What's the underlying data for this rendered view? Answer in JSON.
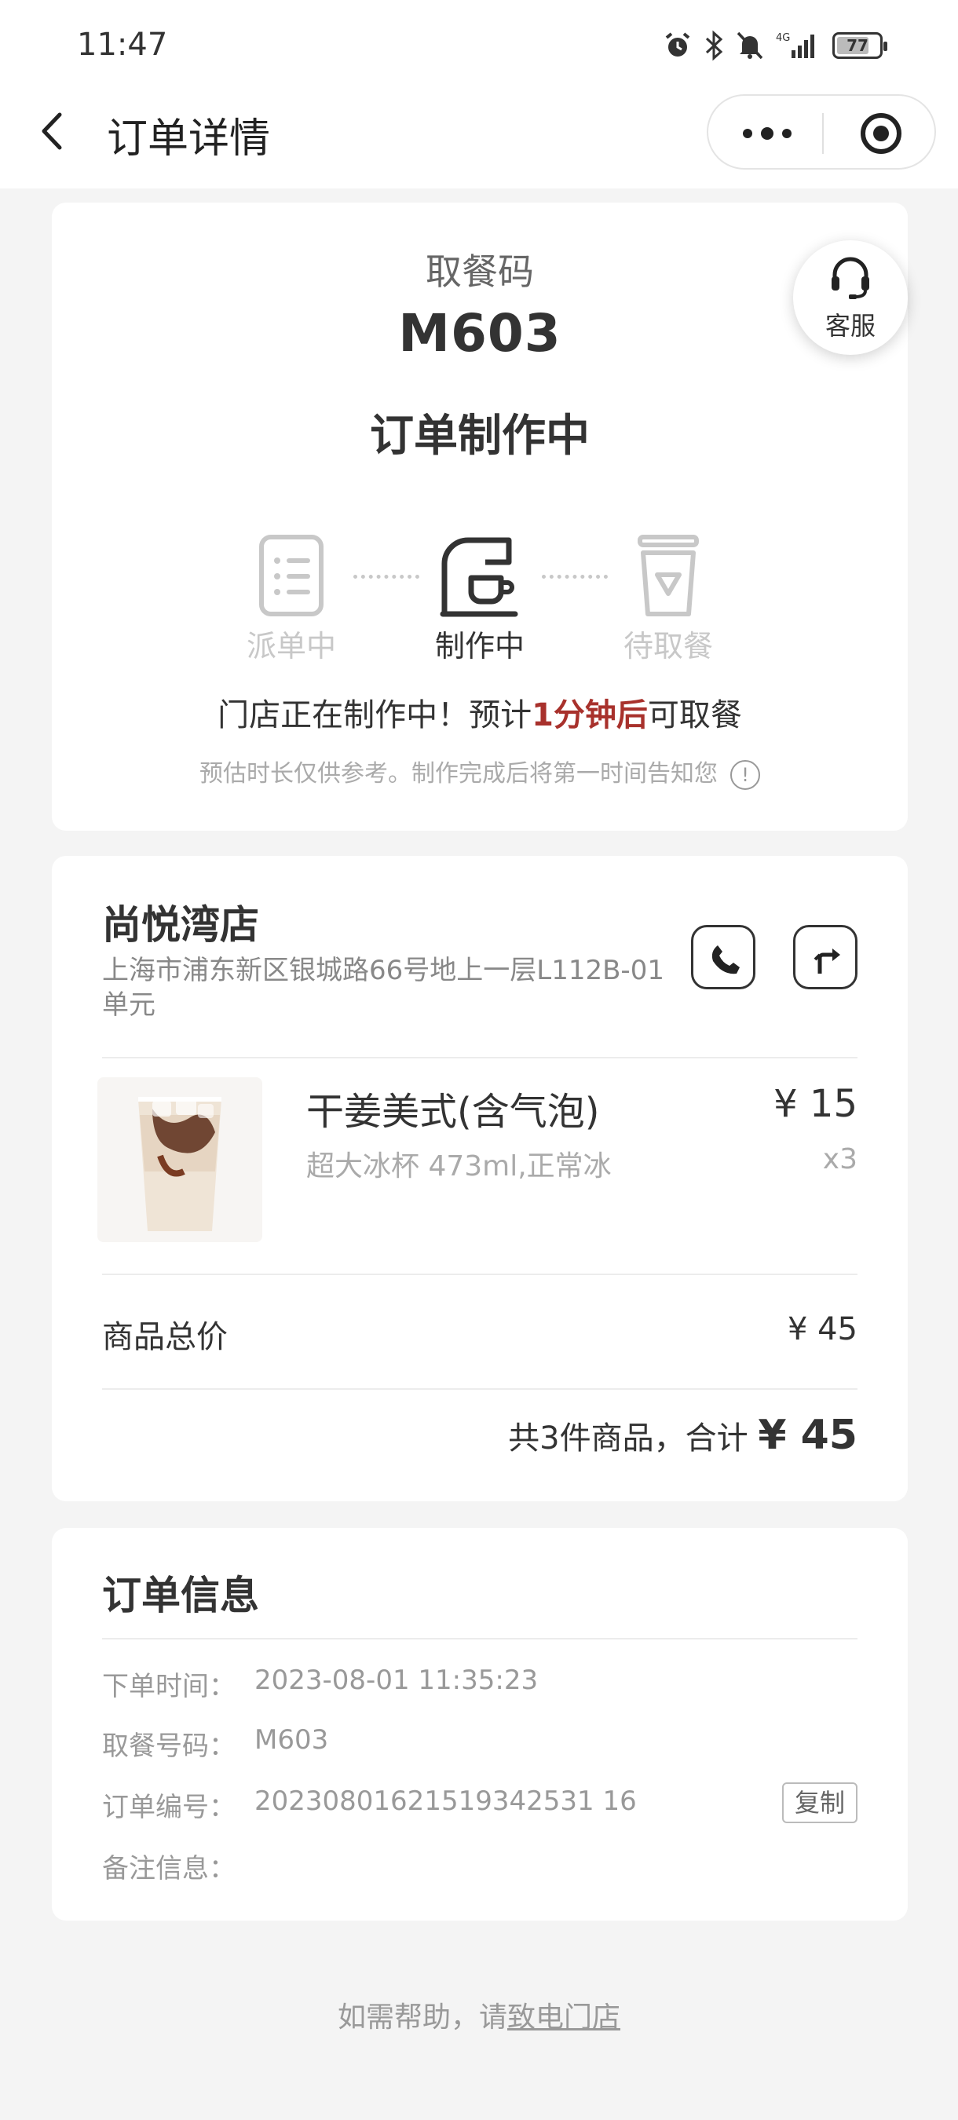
{
  "status_bar": {
    "time": "11:47",
    "network": "4G",
    "battery": "77",
    "battery_level": 0.77,
    "icons": [
      "alarm-icon",
      "bluetooth-icon",
      "mute-icon",
      "signal-icon",
      "battery-icon"
    ]
  },
  "nav": {
    "title": "订单详情"
  },
  "pickup": {
    "label": "取餐码",
    "code": "M603",
    "status": "订单制作中",
    "support_label": "客服"
  },
  "steps": [
    {
      "label": "派单中",
      "state": "done"
    },
    {
      "label": "制作中",
      "state": "active"
    },
    {
      "label": "待取餐",
      "state": "pending"
    }
  ],
  "progress": {
    "prefix": "门店正在制作中！预计",
    "highlight": "1分钟后",
    "suffix": "可取餐",
    "note": "预估时长仅供参考。制作完成后将第一时间告知您",
    "info_icon": "!"
  },
  "store": {
    "name": "尚悦湾店",
    "address": "上海市浦东新区银城路66号地上一层L112B-01单元"
  },
  "items": [
    {
      "name": "干姜美式(含气泡)",
      "spec": "超大冰杯 473ml,正常冰",
      "price": "¥ 15",
      "qty": "x3"
    }
  ],
  "summary": {
    "subtotal_label": "商品总价",
    "subtotal_value": "¥ 45",
    "total_prefix": "共3件商品，合计",
    "total_amount": "¥ 45"
  },
  "order_info": {
    "title": "订单信息",
    "rows": [
      {
        "label": "下单时间：",
        "value": "2023-08-01 11:35:23"
      },
      {
        "label": "取餐号码：",
        "value": "M603"
      },
      {
        "label": "订单编号：",
        "value": "20230801621519342531 16"
      },
      {
        "label": "备注信息：",
        "value": ""
      }
    ],
    "copy_label": "复制"
  },
  "footer": {
    "help_prefix": "如需帮助，请",
    "help_link": "致电门店"
  },
  "colors": {
    "highlight": "#a8312c",
    "background": "#f4f4f4"
  }
}
